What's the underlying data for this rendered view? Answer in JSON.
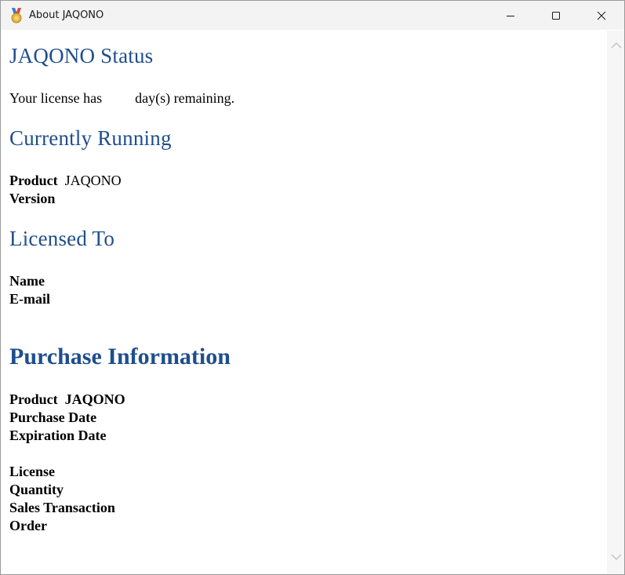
{
  "window": {
    "title": "About JAQONO",
    "icons": {
      "app": "medal-icon",
      "minimize": "minimize-icon",
      "maximize": "maximize-icon",
      "close": "close-icon"
    }
  },
  "status": {
    "heading": "JAQONO Status",
    "license_prefix": "Your license has",
    "license_suffix": "day(s) remaining."
  },
  "running": {
    "heading": "Currently Running",
    "product_label": "Product",
    "product_value": "JAQONO",
    "version_label": "Version"
  },
  "licensed": {
    "heading": "Licensed To",
    "name_label": "Name",
    "email_label": "E-mail"
  },
  "purchase": {
    "heading": "Purchase Information",
    "product_label": "Product",
    "product_value": "JAQONO",
    "purchase_date_label": "Purchase Date",
    "expiration_date_label": "Expiration Date",
    "license_label": "License",
    "quantity_label": "Quantity",
    "sales_transaction_label": "Sales Transaction",
    "order_label": "Order"
  },
  "colors": {
    "heading": "#1f4e8c",
    "titlebar": "#f3f3f3"
  }
}
